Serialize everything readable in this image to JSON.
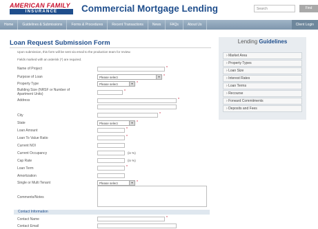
{
  "header": {
    "logo_top": "AMERICAN FAMILY",
    "logo_bottom": "INSURANCE",
    "app_title": "Commercial Mortgage Lending",
    "search_placeholder": "Search",
    "go_label": "Find"
  },
  "nav": {
    "items": [
      "Home",
      "Guidelines & Submissions",
      "Forms & Procedures",
      "Recent Transactions",
      "News",
      "FAQs",
      "About Us"
    ],
    "right_button": "Client Login"
  },
  "page": {
    "title": "Loan Request Submission Form",
    "intro": "Upon submission, this form will be sent via email to the production team for review.",
    "required_note": "Fields marked with an asterisk (*) are required."
  },
  "form": {
    "labels": {
      "project_name": "Name of Project",
      "purpose": "Purpose of Loan",
      "property_type": "Property Type",
      "building_size": "Building Size (NRSF or Number of Apartment Units)",
      "address": "Address",
      "city": "City",
      "state": "State",
      "loan_amount": "Loan Amount",
      "ltv": "Loan To Value Ratio",
      "current_noi": "Current NOI",
      "occupancy": "Current Occupancy",
      "cap_rate": "Cap Rate",
      "loan_term": "Loan Term",
      "amortization": "Amortization",
      "tenant": "Single or Multi Tenant",
      "comments": "Comments/Notes"
    },
    "select_values": {
      "purpose": "Please select",
      "property_type": "Please select",
      "state": "Please select",
      "tenant": "Please select"
    },
    "units": {
      "occupancy": "(in %)",
      "cap_rate": "(in %)"
    },
    "required_mark": "*"
  },
  "contact": {
    "header": "Contact Information",
    "name_label": "Contact Name",
    "email_label": "Contact Email"
  },
  "sidebar": {
    "title_plain": "Lending",
    "title_bold": "Guidelines",
    "items": [
      "Market Area",
      "Property Types",
      "Loan Size",
      "Interest Rates",
      "Loan Terms",
      "Recourse",
      "Forward Commitments",
      "Deposits and Fees"
    ]
  }
}
